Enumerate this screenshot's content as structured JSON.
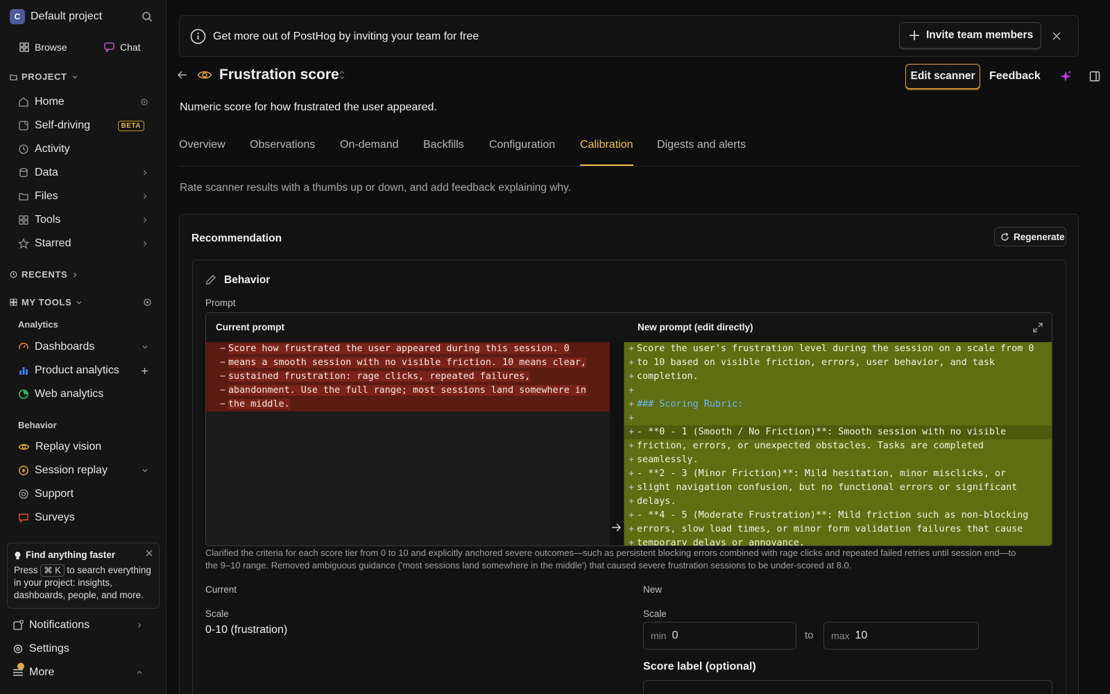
{
  "sidebar": {
    "project_initial": "C",
    "project_name": "Default project",
    "browse_label": "Browse",
    "chat_label": "Chat",
    "project_section": "PROJECT",
    "items": [
      {
        "label": "Home",
        "icon": "home-icon"
      },
      {
        "label": "Self-driving",
        "icon": "self-driving-icon",
        "badge": "BETA"
      },
      {
        "label": "Activity",
        "icon": "clock-icon"
      },
      {
        "label": "Data",
        "icon": "database-icon"
      },
      {
        "label": "Files",
        "icon": "folder-icon"
      },
      {
        "label": "Tools",
        "icon": "grid-icon"
      },
      {
        "label": "Starred",
        "icon": "star-icon"
      }
    ],
    "recents_section": "RECENTS",
    "my_tools_section": "MY TOOLS",
    "analytics_group": "Analytics",
    "analytics_items": [
      {
        "label": "Dashboards"
      },
      {
        "label": "Product analytics"
      },
      {
        "label": "Web analytics"
      }
    ],
    "behavior_group": "Behavior",
    "behavior_items": [
      {
        "label": "Replay vision"
      },
      {
        "label": "Session replay"
      },
      {
        "label": "Support"
      },
      {
        "label": "Surveys"
      }
    ],
    "tip": {
      "title": "Find anything faster",
      "press": "Press",
      "shortcut": "⌘ K",
      "rest_line1": "to search everything",
      "rest_line2": "in your project: insights,",
      "rest_line3": "dashboards, people, and more."
    },
    "notifications_label": "Notifications",
    "settings_label": "Settings",
    "more_label": "More"
  },
  "banner": {
    "text": "Get more out of PostHog by inviting your team for free",
    "invite_label": "Invite team members"
  },
  "header": {
    "title": "Frustration score",
    "description": "Numeric score for how frustrated the user appeared.",
    "edit_label": "Edit scanner",
    "feedback_label": "Feedback"
  },
  "tabs": [
    {
      "label": "Overview"
    },
    {
      "label": "Observations"
    },
    {
      "label": "On-demand"
    },
    {
      "label": "Backfills"
    },
    {
      "label": "Configuration"
    },
    {
      "label": "Calibration",
      "active": true
    },
    {
      "label": "Digests and alerts"
    }
  ],
  "calibration": {
    "intro": "Rate scanner results with a thumbs up or down, and add feedback explaining why.",
    "recommendation_title": "Recommendation",
    "regenerate_label": "Regenerate",
    "behavior_title": "Behavior",
    "prompt_label": "Prompt",
    "current_prompt_header": "Current prompt",
    "new_prompt_header": "New prompt (edit directly)",
    "current_lines": [
      "Score how frustrated the user appeared during this session. 0",
      "means a smooth session with no visible friction. 10 means clear,",
      "sustained frustration: rage clicks, repeated failures,",
      "abandonment. Use the full range; most sessions land somewhere in",
      "the middle."
    ],
    "new_lines": [
      "Score the user's frustration level during the session on a scale from 0",
      "to 10 based on visible friction, errors, user behavior, and task",
      "completion.",
      "",
      "### Scoring Rubric:",
      "",
      "- **0 - 1 (Smooth / No Friction)**: Smooth session with no visible",
      "friction, errors, or unexpected obstacles. Tasks are completed",
      "seamlessly.",
      "- **2 - 3 (Minor Friction)**: Mild hesitation, minor misclicks, or",
      "slight navigation confusion, but no functional errors or significant",
      "delays.",
      "- **4 - 5 (Moderate Frustration)**: Mild friction such as non-blocking",
      "errors, slow load times, or minor form validation failures that cause",
      "temporary delays or annoyance."
    ],
    "explanation_line1": "Clarified the criteria for each score tier from 0 to 10 and explicitly anchored severe outcomes—such as persistent blocking errors combined with rage clicks and repeated failed retries until session end—to",
    "explanation_line2": "the 9–10 range. Removed ambiguous guidance ('most sessions land somewhere in the middle') that caused severe frustration sessions to be under-scored at 8.0.",
    "current_label": "Current",
    "new_label": "New",
    "scale_label": "Scale",
    "current_scale_value": "0-10 (frustration)",
    "min_prefix": "min",
    "min_value": "0",
    "to_label": "to",
    "max_prefix": "max",
    "max_value": "10",
    "score_label_title": "Score label (optional)"
  },
  "colors": {
    "accent": "#f3c04a",
    "removed_bg": "#7a2419",
    "added_bg": "#5f6e12"
  }
}
